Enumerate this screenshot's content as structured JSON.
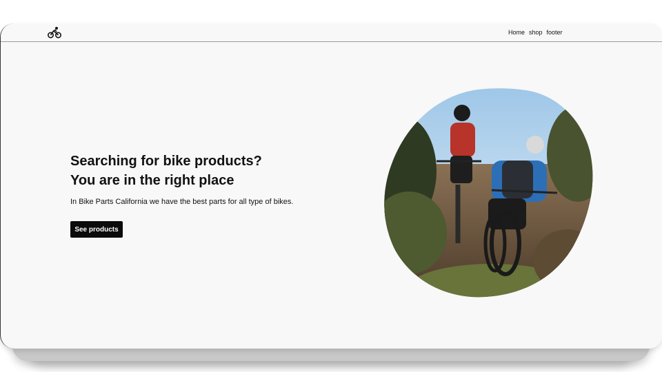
{
  "nav": {
    "logo_icon": "bicycle-rider-icon",
    "links": [
      "Home",
      "shop",
      "footer"
    ]
  },
  "hero": {
    "title_line1": "Searching for bike products?",
    "title_line2": "You are in the right place",
    "text": "In Bike Parts California we have the best parts for all type of bikes.",
    "button_label": "See products",
    "image": "two-mountain-bikers-on-trail"
  },
  "colors": {
    "page_bg": "#f8f8f8",
    "text": "#111111",
    "button_bg": "#0b0b0b",
    "button_text": "#ffffff"
  }
}
